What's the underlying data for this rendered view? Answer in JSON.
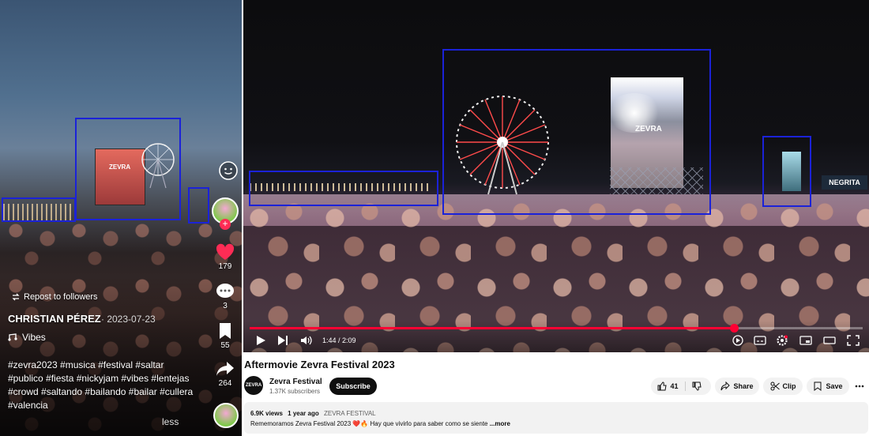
{
  "tiktok": {
    "repost_label": "Repost to followers",
    "author": "CHRISTIAN PÉREZ",
    "date": "· 2023-07-23",
    "sound": "Vibes",
    "hashtags": "#zevra2023 #musica #festival #saltar #publico #fiesta #nickyjam #vibes #lentejas #crowd #saltando #bailando #bailar #cullera #valencia",
    "less_label": "less",
    "stage_logo": "ZEVRA",
    "like_count": "179",
    "comment_count": "3",
    "save_count": "55",
    "share_count": "264",
    "accent_color": "#fe2c55"
  },
  "youtube": {
    "stage_logo": "ZEVRA",
    "sign_text": "NEGRITA",
    "time": "1:44 / 2:09",
    "progress": 0.79,
    "video_title": "Aftermovie Zevra Festival 2023",
    "channel_name": "Zevra Festival",
    "channel_avatar_text": "ZEVRA",
    "subscribers": "1.37K subscribers",
    "subscribe_label": "Subscribe",
    "like_count": "41",
    "share_label": "Share",
    "clip_label": "Clip",
    "save_label": "Save",
    "views": "6.9K views",
    "age": "1 year ago",
    "channel_tag": "ZEVRA FESTIVAL",
    "description": "Rememoramos Zevra Festival 2023 ❤️🔥 Hay que vivirlo para saber como se siente",
    "more_label": " ...more",
    "progress_color": "#ff0033"
  },
  "annotation_color": "#1b22d8"
}
